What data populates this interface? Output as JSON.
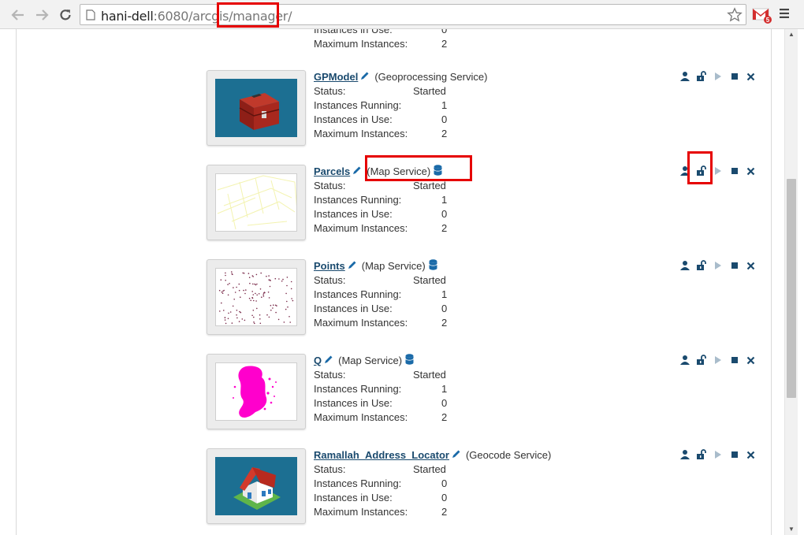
{
  "browser": {
    "url_host": "hani-dell",
    "url_rest": ":6080/arcgis/",
    "url_path": "manager/",
    "extension_badge": "5"
  },
  "labels": {
    "status": "Status:",
    "running": "Instances Running:",
    "in_use": "Instances in Use:",
    "max": "Maximum Instances:"
  },
  "partial_service": {
    "in_use": "0",
    "max": "2"
  },
  "services": [
    {
      "name": "GPModel",
      "type": "(Geoprocessing Service)",
      "status": "Started",
      "running": "1",
      "in_use": "0",
      "max": "2",
      "has_db": false,
      "thumbnail": "toolbox-icon"
    },
    {
      "name": "Parcels",
      "type": "(Map Service)",
      "status": "Started",
      "running": "1",
      "in_use": "0",
      "max": "2",
      "has_db": true,
      "thumbnail": "parcels-map"
    },
    {
      "name": "Points",
      "type": "(Map Service)",
      "status": "Started",
      "running": "1",
      "in_use": "0",
      "max": "2",
      "has_db": true,
      "thumbnail": "points-map"
    },
    {
      "name": "Q",
      "type": "(Map Service)",
      "status": "Started",
      "running": "1",
      "in_use": "0",
      "max": "2",
      "has_db": true,
      "thumbnail": "magenta-map"
    },
    {
      "name": "Ramallah_Address_Locator",
      "type": "(Geocode Service)",
      "status": "Started",
      "running": "0",
      "in_use": "0",
      "max": "2",
      "has_db": false,
      "thumbnail": "house-icon"
    }
  ],
  "colors": {
    "action_icon": "#1a4a6e",
    "start_icon_disabled": "#a9bccb",
    "highlight": "#e60000",
    "magenta": "#ff00cc"
  }
}
